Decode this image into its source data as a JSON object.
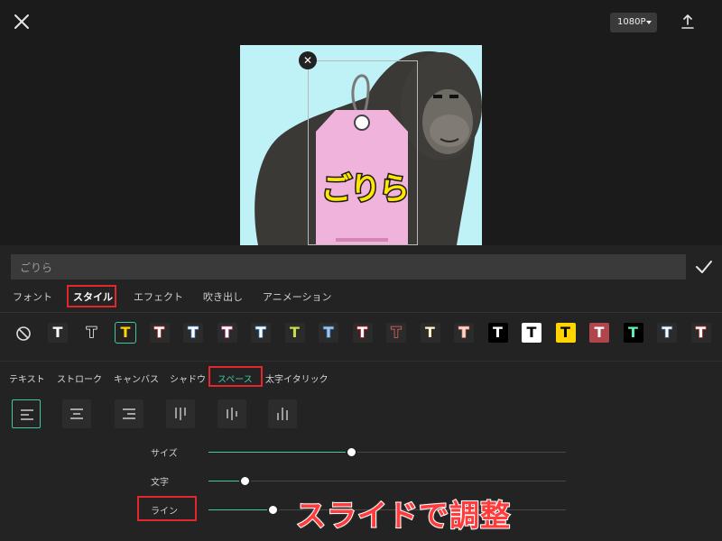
{
  "toolbar": {
    "resolution_label": "1080P",
    "close_icon": "close-icon",
    "export_icon": "export-icon"
  },
  "preview": {
    "background_color": "#bff2f7",
    "sticker_text": "ごりら",
    "tag_color": "#f0b3dc",
    "text_color": "#ffe500"
  },
  "text_input": {
    "value": "ごりら"
  },
  "tabs": [
    {
      "label": "フォント"
    },
    {
      "label": "スタイル",
      "active": true
    },
    {
      "label": "エフェクト"
    },
    {
      "label": "吹き出し"
    },
    {
      "label": "アニメーション"
    }
  ],
  "style_presets": [
    {
      "glyph": "T",
      "fg": "#ffffff",
      "bg": "#2b2b2b",
      "stroke": ""
    },
    {
      "glyph": "T",
      "fg": "#1c1c1c",
      "bg": "transparent",
      "stroke": "#ffffff"
    },
    {
      "glyph": "T",
      "fg": "#ffd400",
      "bg": "#222222",
      "stroke": "",
      "selected": true
    },
    {
      "glyph": "T",
      "fg": "#ffffff",
      "bg": "#2b2b2b",
      "stroke": "#d9454a"
    },
    {
      "glyph": "T",
      "fg": "#ffffff",
      "bg": "#2b2b2b",
      "stroke": "#6fa7e8"
    },
    {
      "glyph": "T",
      "fg": "#ffffff",
      "bg": "#2b2b2b",
      "stroke": "#ef6fb7"
    },
    {
      "glyph": "T",
      "fg": "#ffffff",
      "bg": "#2b2b2b",
      "stroke": "#4a9fe6"
    },
    {
      "glyph": "T",
      "fg": "#c7e04a",
      "bg": "#2b2b2b",
      "stroke": ""
    },
    {
      "glyph": "T",
      "fg": "#9ec7f0",
      "bg": "#2b2b2b",
      "stroke": "#3d6d9e"
    },
    {
      "glyph": "T",
      "fg": "#ffffff",
      "bg": "#2b2b2b",
      "stroke": "#d92b3a"
    },
    {
      "glyph": "T",
      "fg": "#2b2b2b",
      "bg": "#2b2b2b",
      "stroke": "#e56b6b"
    },
    {
      "glyph": "T",
      "fg": "#fff4c7",
      "bg": "#2b2b2b",
      "stroke": ""
    },
    {
      "glyph": "T",
      "fg": "#ffd9c7",
      "bg": "#2b2b2b",
      "stroke": "#e28a7a"
    },
    {
      "glyph": "T",
      "fg": "#ffffff",
      "bg": "#000000",
      "stroke": ""
    },
    {
      "glyph": "T",
      "fg": "#000000",
      "bg": "#ffffff",
      "stroke": ""
    },
    {
      "glyph": "T",
      "fg": "#000000",
      "bg": "#ffd400",
      "stroke": ""
    },
    {
      "glyph": "T",
      "fg": "#ffffff",
      "bg": "#b0464c",
      "stroke": ""
    },
    {
      "glyph": "T",
      "fg": "#5ef0b5",
      "bg": "#000000",
      "stroke": ""
    },
    {
      "glyph": "T",
      "fg": "#ffffff",
      "bg": "#2b2b2b",
      "stroke": "#4a6fa0"
    },
    {
      "glyph": "T",
      "fg": "#ffffff",
      "bg": "#2b2b2b",
      "stroke": "#c44"
    }
  ],
  "subtabs": [
    {
      "label": "テキスト"
    },
    {
      "label": "ストローク"
    },
    {
      "label": "キャンバス"
    },
    {
      "label": "シャドウ"
    },
    {
      "label": "スペース",
      "active": true
    },
    {
      "label": "太字イタリック"
    }
  ],
  "alignment_buttons": [
    {
      "name": "align-left",
      "active": true
    },
    {
      "name": "align-center"
    },
    {
      "name": "align-right"
    },
    {
      "name": "vertical-top"
    },
    {
      "name": "vertical-center"
    },
    {
      "name": "vertical-bottom"
    }
  ],
  "sliders": [
    {
      "label": "サイズ",
      "value": 0.4
    },
    {
      "label": "文字",
      "value": 0.1
    },
    {
      "label": "ライン",
      "value": 0.18
    }
  ],
  "annotation": {
    "text": "スライドで調整",
    "color": "#ff3b3b"
  },
  "colors": {
    "accent": "#3fc7a6",
    "highlight": "#e3262c",
    "panel_bg": "#232323"
  }
}
